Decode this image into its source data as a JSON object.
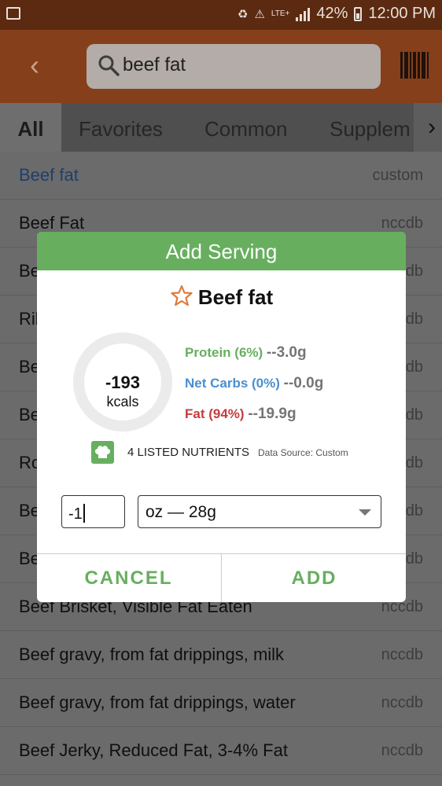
{
  "status_bar": {
    "battery": "42%",
    "time": "12:00 PM",
    "network": "LTE+"
  },
  "search": {
    "query": "beef fat"
  },
  "tabs": [
    "All",
    "Favorites",
    "Common",
    "Supplem"
  ],
  "foods": [
    {
      "name": "Beef fat",
      "source": "custom"
    },
    {
      "name": "Beef Fat",
      "source": "nccdb"
    },
    {
      "name": "Be",
      "source": "db"
    },
    {
      "name": "Ril",
      "source": "db"
    },
    {
      "name": "Be",
      "source": "db"
    },
    {
      "name": "Be",
      "source": "db"
    },
    {
      "name": "Ro",
      "source": "db"
    },
    {
      "name": "Be",
      "source": "db"
    },
    {
      "name": "Be",
      "source": "db"
    },
    {
      "name": "Beef Brisket, Visible Fat Eaten",
      "source": "nccdb"
    },
    {
      "name": "Beef gravy, from fat drippings, milk",
      "source": "nccdb"
    },
    {
      "name": "Beef gravy, from fat drippings, water",
      "source": "nccdb"
    },
    {
      "name": "Beef Jerky, Reduced Fat, 3-4% Fat",
      "source": "nccdb"
    }
  ],
  "dialog": {
    "title": "Add Serving",
    "food_name": "Beef fat",
    "kcal_value": "-193",
    "kcal_label": "kcals",
    "protein": {
      "label": "Protein (6%)",
      "value": "--3.0g"
    },
    "net_carbs": {
      "label": "Net Carbs (0%)",
      "value": "--0.0g"
    },
    "fat": {
      "label": "Fat (94%)",
      "value": "--19.9g"
    },
    "nutrients_label": "4 LISTED NUTRIENTS",
    "data_source": "Data Source: Custom",
    "quantity": "-1",
    "unit": "oz  — 28g",
    "cancel_label": "CANCEL",
    "add_label": "ADD"
  },
  "colors": {
    "accent_green": "#67af5f",
    "app_bar": "#c5622d",
    "protein": "#67af5f",
    "carbs": "#4a8fd0",
    "fat": "#c43c3c"
  }
}
